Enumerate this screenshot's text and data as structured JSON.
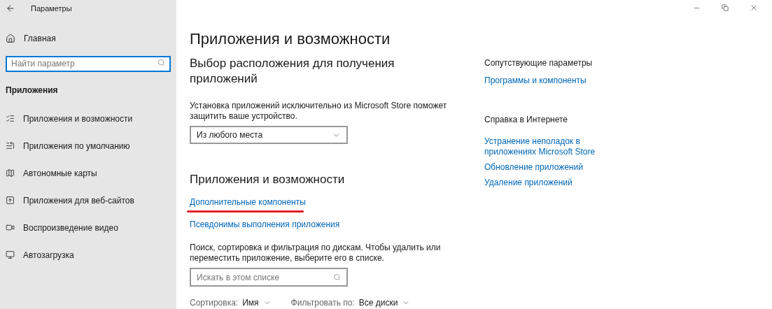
{
  "window": {
    "title": "Параметры"
  },
  "sidebar": {
    "home": "Главная",
    "search": {
      "placeholder": "Найти параметр"
    },
    "section": "Приложения",
    "items": [
      {
        "label": "Приложения и возможности"
      },
      {
        "label": "Приложения по умолчанию"
      },
      {
        "label": "Автономные карты"
      },
      {
        "label": "Приложения для веб-сайтов"
      },
      {
        "label": "Воспроизведение видео"
      },
      {
        "label": "Автозагрузка"
      }
    ]
  },
  "main": {
    "title": "Приложения и возможности",
    "install_heading": "Выбор расположения для получения приложений",
    "install_text": "Установка приложений исключительно из Microsoft Store поможет защитить ваше устройство.",
    "install_dropdown": "Из любого места",
    "apps_heading": "Приложения и возможности",
    "links": [
      {
        "label": "Дополнительные компоненты",
        "marked": true
      },
      {
        "label": "Псевдонимы выполнения приложения",
        "marked": false
      }
    ],
    "apps_text": "Поиск, сортировка и фильтрация по дискам. Чтобы удалить или переместить приложение, выберите его в списке.",
    "apps_search": {
      "placeholder": "Искать в этом списке"
    },
    "sort": {
      "label": "Сортировка:",
      "value": "Имя"
    },
    "filter": {
      "label": "Фильтровать по:",
      "value": "Все диски"
    }
  },
  "related": {
    "heading": "Сопутствующие параметры",
    "links": [
      "Программы и компоненты"
    ]
  },
  "help": {
    "heading": "Справка в Интернете",
    "links": [
      "Устранение неполадок в приложениях Microsoft Store",
      "Обновление приложений",
      "Удаление приложений"
    ]
  }
}
